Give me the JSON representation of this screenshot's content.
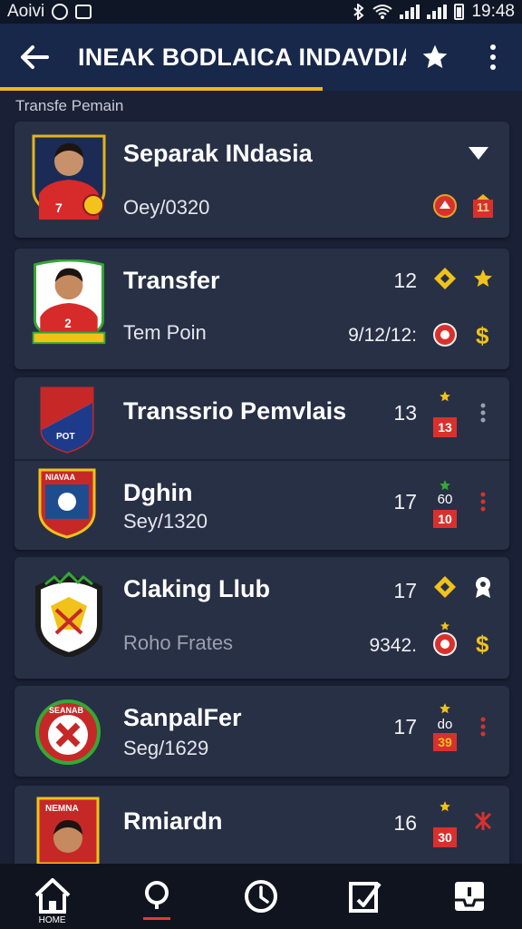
{
  "status_bar": {
    "carrier": "Aoivi",
    "time": "19:48"
  },
  "app_bar": {
    "title": "INEAK BODLAICA INDAVDIA"
  },
  "section": {
    "label": "Transfe Pemain"
  },
  "cards": [
    {
      "name": "Separak INdasia",
      "sub": "Oey/0320"
    },
    {
      "name": "Transfer",
      "number": "12",
      "sub": "Tem Poin",
      "date": "9/12/12:"
    },
    {
      "rows": [
        {
          "name": "Transsrio Pemvlais",
          "number": "13",
          "badge": "13"
        },
        {
          "name": "Dghin",
          "sub": "Sey/1320",
          "number": "17",
          "score": "60",
          "badge": "10"
        }
      ]
    },
    {
      "name": "Claking Llub",
      "number": "17",
      "sub": "Roho Frates",
      "date": "9342."
    },
    {
      "name": "SanpalFer",
      "number": "17",
      "sub": "Seg/1629",
      "score": "do",
      "badge": "39"
    },
    {
      "name": "Rmiardn",
      "number": "16",
      "badge": "30"
    }
  ],
  "badges": {
    "card1_jersey": "11",
    "card1_avatar_number": "7",
    "card2_avatar_number": "2",
    "crest_card3": "POT",
    "crest_card3b": "NIAVAA",
    "crest_card5": "SEANAB",
    "crest_card6": "NEMNA"
  },
  "nav": {
    "home_label": "HOME"
  },
  "colors": {
    "background": "#1a2136",
    "app_bar": "#17284a",
    "card": "#283046",
    "accent_gold": "#f0b51c",
    "accent_red": "#d8312d"
  },
  "icons": [
    "arrow-back-icon",
    "star-icon",
    "more-vert-icon",
    "chevron-down-icon",
    "diamond-icon",
    "dollar-icon",
    "home-icon",
    "search-icon",
    "clock-icon",
    "edit-icon",
    "inbox-icon"
  ]
}
